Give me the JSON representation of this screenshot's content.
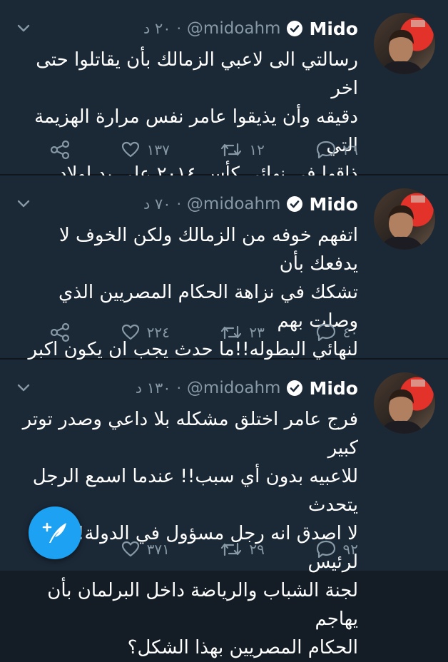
{
  "tweets": [
    {
      "name": "Mido",
      "handle": "@midoahm",
      "dot": "·",
      "time": "٢٠ د",
      "text": "رسالتي الى لاعبي الزمالك بأن يقاتلوا حتى اخر\nدقيقه وأن يذيقوا عامر نفس مرارة الهزيمة التي\nذاقها في نهائي كأس ٢٠١٤ على يد اولاد الزمالك!!",
      "replies": "٢٦",
      "retweets": "١٢",
      "likes": "١٣٧"
    },
    {
      "name": "Mido",
      "handle": "@midoahm",
      "dot": "·",
      "time": "٧٠ د",
      "text": "اتفهم خوفه من الزمالك ولكن الخوف لا يدفعك بأن\nتشكك في نزاهة الحكام المصريين الذي وصلت بهم\nلنهائي البطوله!!ما حدث يجب ان يكون اكبر دافع\nللاعبي الزمالك بأن يقاتلوا في كل ثانيه في المباراة!!",
      "replies": "٤٠",
      "retweets": "٢٣",
      "likes": "٢٢٤"
    },
    {
      "name": "Mido",
      "handle": "@midoahm",
      "dot": "·",
      "time": "١٣٠ د",
      "text": "فرج عامر اختلق مشكله بلا داعي وصدر توتر كبير\nللاعبيه بدون أي سبب!! عندما اسمع الرجل يتحدث\nلا اصدق انه رجل مسؤول في الدولة!! كيف لرئيس\nلجنة الشباب والرياضة داخل البرلمان بأن يهاجم\nالحكام المصريين بهذا الشكل؟",
      "replies": "٩٢",
      "retweets": "٢٩",
      "likes": "٣٧١"
    }
  ],
  "colors": {
    "background": "#141d26",
    "card": "#1b2836",
    "muted": "#8899a6",
    "accent": "#1da1f2"
  },
  "icons": [
    "chevron-down-icon",
    "verified-icon",
    "share-icon",
    "like-icon",
    "retweet-icon",
    "reply-icon",
    "compose-tweet-icon"
  ]
}
